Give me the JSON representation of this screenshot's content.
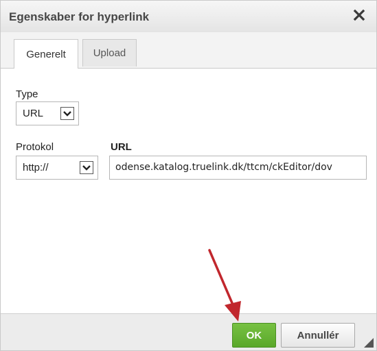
{
  "dialog": {
    "title": "Egenskaber for hyperlink",
    "close_icon": "close-icon"
  },
  "tabs": [
    {
      "label": "Generelt",
      "active": true
    },
    {
      "label": "Upload",
      "active": false
    }
  ],
  "form": {
    "type_label": "Type",
    "type_value": "URL",
    "protocol_label": "Protokol",
    "protocol_value": "http://",
    "url_label": "URL",
    "url_value": "odense.katalog.truelink.dk/ttcm/ckEditor/dov"
  },
  "footer": {
    "ok_label": "OK",
    "cancel_label": "Annullér"
  },
  "colors": {
    "ok_button": "#5aa82a",
    "annotation_arrow": "#c1272d"
  }
}
